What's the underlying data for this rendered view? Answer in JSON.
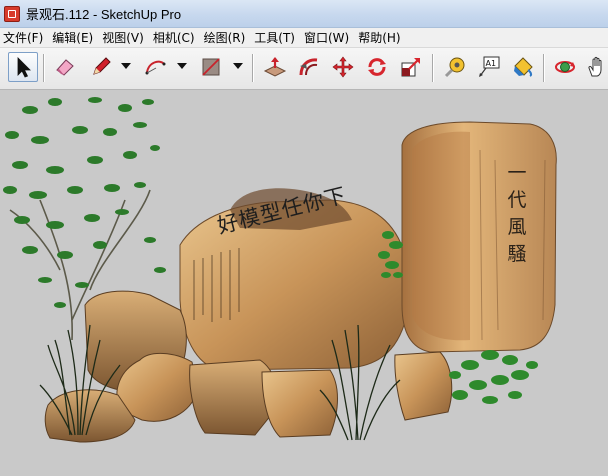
{
  "window": {
    "title": "景观石.112 - SketchUp Pro"
  },
  "menu": [
    "文件(F)",
    "编辑(E)",
    "视图(V)",
    "相机(C)",
    "绘图(R)",
    "工具(T)",
    "窗口(W)",
    "帮助(H)"
  ],
  "toolbar": {
    "tools": [
      {
        "name": "select-tool",
        "icon": "arrow-cursor-icon"
      },
      {
        "name": "eraser-tool",
        "icon": "eraser-icon"
      },
      {
        "name": "pencil-tool",
        "icon": "pencil-icon"
      },
      {
        "name": "arc-tool",
        "icon": "arc-icon"
      },
      {
        "name": "rectangle-tool",
        "icon": "rectangle-icon"
      },
      {
        "name": "push-pull-tool",
        "icon": "push-pull-icon"
      },
      {
        "name": "follow-me-tool",
        "icon": "follow-me-icon"
      },
      {
        "name": "move-tool",
        "icon": "move-arrows-icon"
      },
      {
        "name": "rotate-tool",
        "icon": "rotate-icon"
      },
      {
        "name": "scale-tool",
        "icon": "scale-icon"
      },
      {
        "name": "tape-measure-tool",
        "icon": "tape-measure-icon"
      },
      {
        "name": "text-tool",
        "icon": "text-label-icon"
      },
      {
        "name": "paint-bucket-tool",
        "icon": "paint-bucket-icon"
      },
      {
        "name": "orbit-tool",
        "icon": "orbit-icon"
      },
      {
        "name": "pan-tool",
        "icon": "hand-icon"
      }
    ],
    "text_tool_label": "A1"
  },
  "viewport": {
    "watermark": "好模型任你下",
    "stone_inscription": "一代風騷",
    "background_color": "#c9c9c9"
  }
}
